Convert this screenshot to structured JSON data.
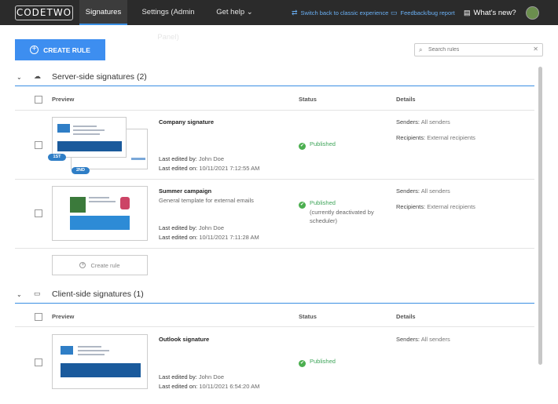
{
  "topbar": {
    "logo": "CODETWO",
    "nav": [
      {
        "label": "Signatures",
        "active": true
      },
      {
        "label": "Settings (Admin Panel)",
        "active": false
      },
      {
        "label": "Get help ⌄",
        "active": false
      }
    ],
    "switch_link": "Switch back to classic experience",
    "feedback_link": "Feedback/bug report",
    "whats_new": "What's new?"
  },
  "toolbar": {
    "create_rule_label": "CREATE RULE",
    "search_placeholder": "Search rules"
  },
  "columns": {
    "preview": "Preview",
    "status": "Status",
    "details": "Details"
  },
  "server_section": {
    "title": "Server-side signatures (2)",
    "rules": [
      {
        "name": "Company signature",
        "description": "",
        "edited_by_label": "Last edited by:",
        "edited_by": "John Doe",
        "edited_on_label": "Last edited on:",
        "edited_on": "10/11/2021 7:12:55 AM",
        "status": "Published",
        "status_note": "",
        "senders_label": "Senders:",
        "senders": "All senders",
        "recipients_label": "Recipients:",
        "recipients": "External recipients",
        "badges": [
          "1ST",
          "2ND"
        ]
      },
      {
        "name": "Summer campaign",
        "description": "General template for external emails",
        "edited_by_label": "Last edited by:",
        "edited_by": "John Doe",
        "edited_on_label": "Last edited on:",
        "edited_on": "10/11/2021 7:11:28 AM",
        "status": "Published",
        "status_note_1": "(currently deactivated by",
        "status_note_2": "scheduler)",
        "senders_label": "Senders:",
        "senders": "All senders",
        "recipients_label": "Recipients:",
        "recipients": "External recipients"
      }
    ],
    "create_rule_inline": "Create rule"
  },
  "client_section": {
    "title": "Client-side signatures (1)",
    "rules": [
      {
        "name": "Outlook signature",
        "edited_by_label": "Last edited by:",
        "edited_by": "John Doe",
        "edited_on_label": "Last edited on:",
        "edited_on": "10/11/2021 6:54:20 AM",
        "status": "Published",
        "senders_label": "Senders:",
        "senders": "All senders"
      }
    ]
  },
  "colors": {
    "accent": "#3d8ef0",
    "topbar": "#2b2b2b",
    "published": "#3fa55a"
  },
  "icons": {
    "cloud": "cloud-icon",
    "monitor": "monitor-icon",
    "search": "search-icon",
    "close": "close-icon",
    "check": "check-circle-icon",
    "plus": "plus-circle-icon"
  }
}
